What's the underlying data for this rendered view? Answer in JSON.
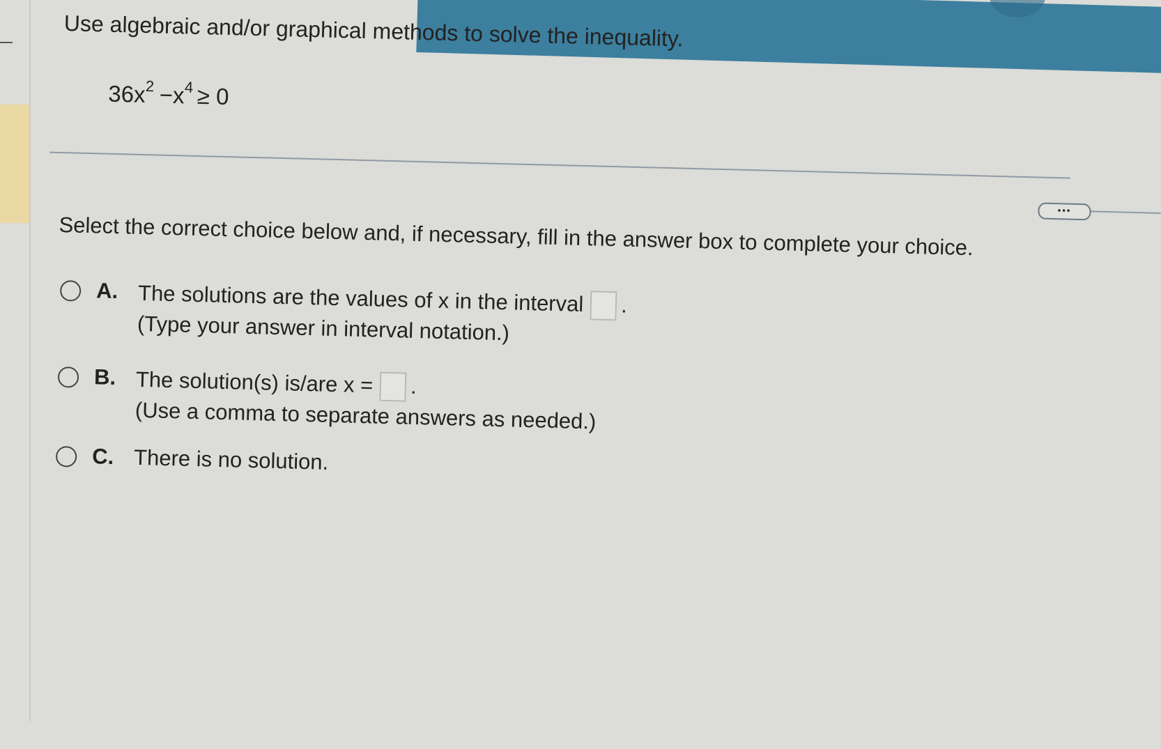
{
  "question": {
    "instruction": "Use algebraic and/or graphical methods to solve the inequality.",
    "inequality": {
      "coef": "36x",
      "exp1": "2",
      "minus": "−x",
      "exp2": "4",
      "rel": "≥ 0"
    }
  },
  "more_button": {
    "label": "•••"
  },
  "prompt": "Select the correct choice below and, if necessary, fill in the answer box to complete your choice.",
  "choices": [
    {
      "letter": "A.",
      "text": "The solutions are the values of x in the interval",
      "suffix": ".",
      "hint": "(Type your answer in interval notation.)"
    },
    {
      "letter": "B.",
      "text": "The solution(s) is/are x =",
      "suffix": ".",
      "hint": "(Use a comma to separate answers as needed.)"
    },
    {
      "letter": "C.",
      "text": "There is no solution."
    }
  ],
  "colors": {
    "background": "#dcdcd8",
    "top_band": "#3d7f9e",
    "left_highlight": "#ead8a2",
    "divider": "#8f9aa2"
  }
}
